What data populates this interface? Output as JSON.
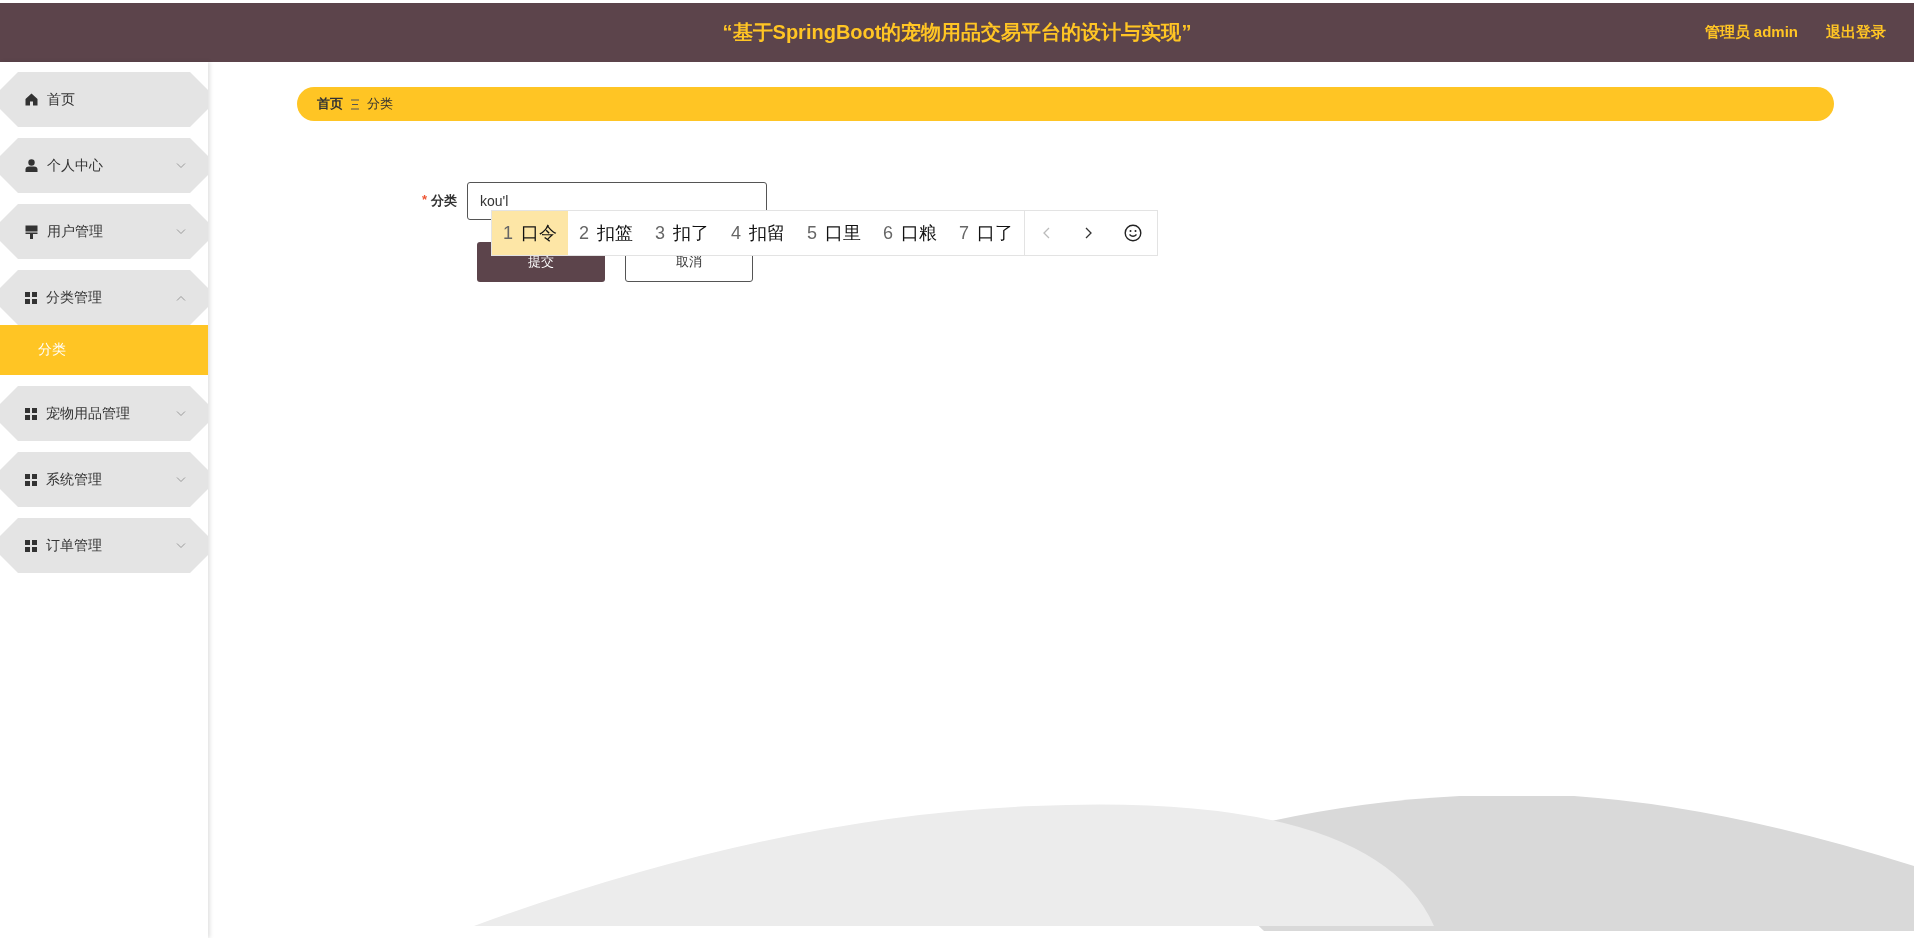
{
  "header": {
    "title": "“基于SpringBoot的宠物用品交易平台的设计与实现”",
    "user_label": "管理员 admin",
    "logout": "退出登录"
  },
  "sidebar": {
    "items": [
      {
        "label": "首页",
        "selected": false
      },
      {
        "label": "个人中心",
        "selected": false,
        "expanded": false
      },
      {
        "label": "用户管理",
        "selected": false,
        "expanded": false
      },
      {
        "label": "分类管理",
        "selected": false,
        "expanded": true,
        "children": [
          {
            "label": "分类",
            "selected": true
          }
        ]
      },
      {
        "label": "宠物用品管理",
        "selected": false,
        "expanded": false
      },
      {
        "label": "系统管理",
        "selected": false,
        "expanded": false
      },
      {
        "label": "订单管理",
        "selected": false,
        "expanded": false
      }
    ]
  },
  "breadcrumb": [
    "首页",
    "分类"
  ],
  "form": {
    "field": {
      "label": "分类",
      "required": true,
      "required_mark": "*",
      "value": "kou'l"
    },
    "buttons": [
      {
        "label": "提交",
        "kind": "primary"
      },
      {
        "label": "取消",
        "kind": "default"
      }
    ]
  },
  "ime": {
    "prev_disabled": true,
    "candidates": [
      {
        "index": "1",
        "text": "口令",
        "selected": true
      },
      {
        "index": "2",
        "text": "扣篮",
        "selected": false
      },
      {
        "index": "3",
        "text": "扣了",
        "selected": false
      },
      {
        "index": "4",
        "text": "扣留",
        "selected": false
      },
      {
        "index": "5",
        "text": "口里",
        "selected": false
      },
      {
        "index": "6",
        "text": "口粮",
        "selected": false
      },
      {
        "index": "7",
        "text": "口了",
        "selected": false
      }
    ]
  }
}
